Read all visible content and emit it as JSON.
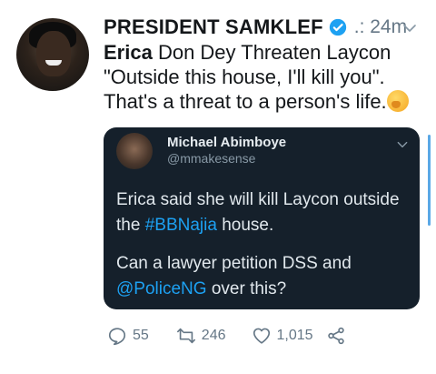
{
  "tweet": {
    "author_name": "PRESIDENT SAMKLEF",
    "time": ".: 24m",
    "text_bold": "Erica",
    "text_line1_rest": " Don Dey Threaten Laycon",
    "text_line2": "\"Outside this house, I'll kill you\".",
    "text_line3": "That's a threat to a person's life.",
    "emoji": "thinking-face"
  },
  "quote": {
    "author_name": "Michael Abimboye",
    "handle": "@mmakesense",
    "para1_a": "Erica said she will kill Laycon outside the ",
    "para1_hashtag": "#BBNajia",
    "para1_b": " house.",
    "para2_a": "Can a lawyer petition DSS and ",
    "para2_mention": "@PoliceNG",
    "para2_b": " over this?"
  },
  "actions": {
    "reply_count": "55",
    "retweet_count": "246",
    "like_count": "1,015"
  },
  "colors": {
    "accent": "#1da1f2",
    "muted": "#657786",
    "quote_bg": "#15202b"
  }
}
